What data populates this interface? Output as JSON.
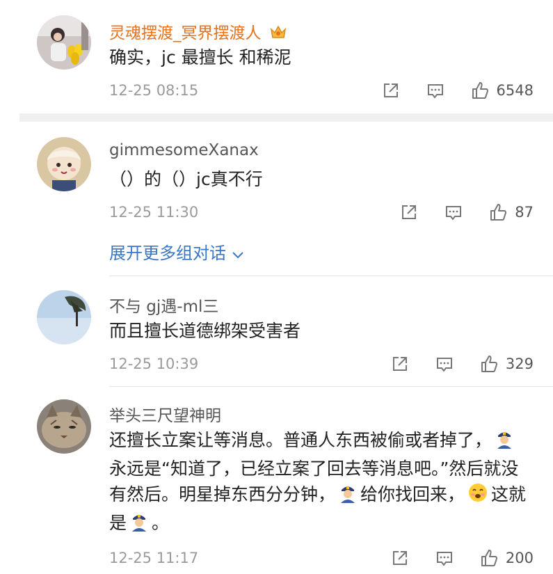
{
  "comments": [
    {
      "username": "灵魂摆渡_冥界摆渡人",
      "text": "确实，jc 最擅长 和稀泥",
      "time": "12-25 08:15",
      "likes": "6548",
      "avatar_icon": "avatar-photo-girl-with-balloons",
      "badge_icon": "crown-badge-icon"
    },
    {
      "username": "gimmesomeXanax",
      "text": "（）的（）jc真不行",
      "time": "12-25 11:30",
      "likes": "87",
      "avatar_icon": "avatar-cartoon-girl"
    },
    {
      "username": "不与 gj遇-ml三",
      "text": "而且擅长道德绑架受害者",
      "time": "12-25 10:39",
      "likes": "329",
      "avatar_icon": "avatar-sky-tree"
    },
    {
      "username": "举头三尺望神明",
      "text_parts": [
        "还擅长立案让等消息。普通人东西被偷或者掉了，",
        "永远是“知道了，已经立案了回去等消息吧。”然后就没有然后。明星掉东西分分钟，",
        "给你找回来，",
        "这就是",
        "。"
      ],
      "time": "12-25 11:17",
      "likes": "200",
      "avatar_icon": "avatar-lynx-cat"
    }
  ],
  "expand_thread_label": "展开更多组对话",
  "icons": {
    "share": "share-icon",
    "comment": "comment-icon",
    "like": "thumbs-up-icon",
    "police": "police-officer-emoji-icon",
    "smile": "smiling-face-emoji-icon"
  },
  "colors": {
    "vip_name": "#e8711a",
    "link": "#3a76c8",
    "meta": "#9a9a9a"
  }
}
